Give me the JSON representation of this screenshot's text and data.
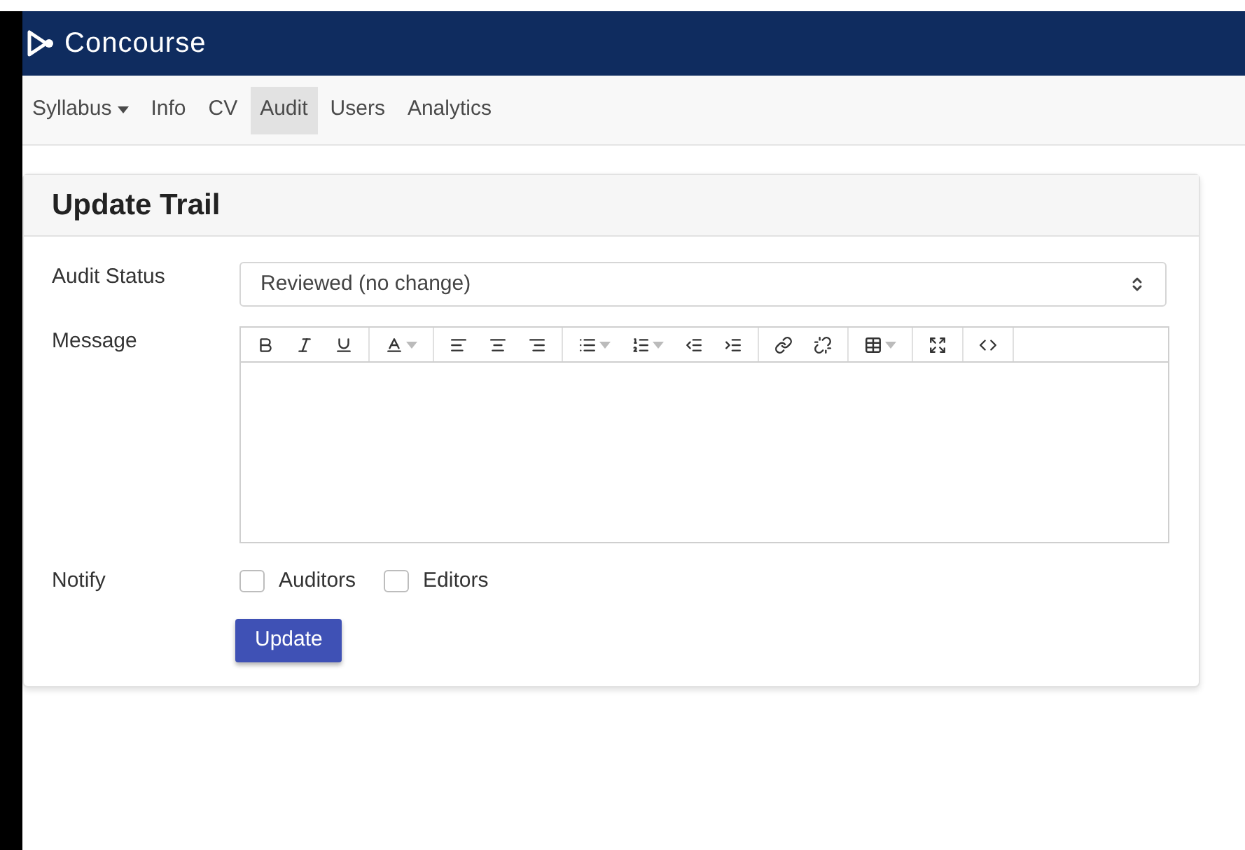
{
  "brand": {
    "name": "Concourse"
  },
  "nav": [
    {
      "label": "Syllabus",
      "kind": "dropdown",
      "selected": false
    },
    {
      "label": "Info",
      "kind": "link",
      "selected": false
    },
    {
      "label": "CV",
      "kind": "link",
      "selected": false
    },
    {
      "label": "Audit",
      "kind": "link",
      "selected": true
    },
    {
      "label": "Users",
      "kind": "link",
      "selected": false
    },
    {
      "label": "Analytics",
      "kind": "link",
      "selected": false
    }
  ],
  "card": {
    "title": "Update Trail",
    "audit_status": {
      "label": "Audit Status",
      "value": "Reviewed (no change)"
    },
    "message": {
      "label": "Message"
    },
    "notify": {
      "label": "Notify",
      "options": [
        {
          "label": "Auditors",
          "checked": false
        },
        {
          "label": "Editors",
          "checked": false
        }
      ]
    },
    "submit": "Update"
  }
}
